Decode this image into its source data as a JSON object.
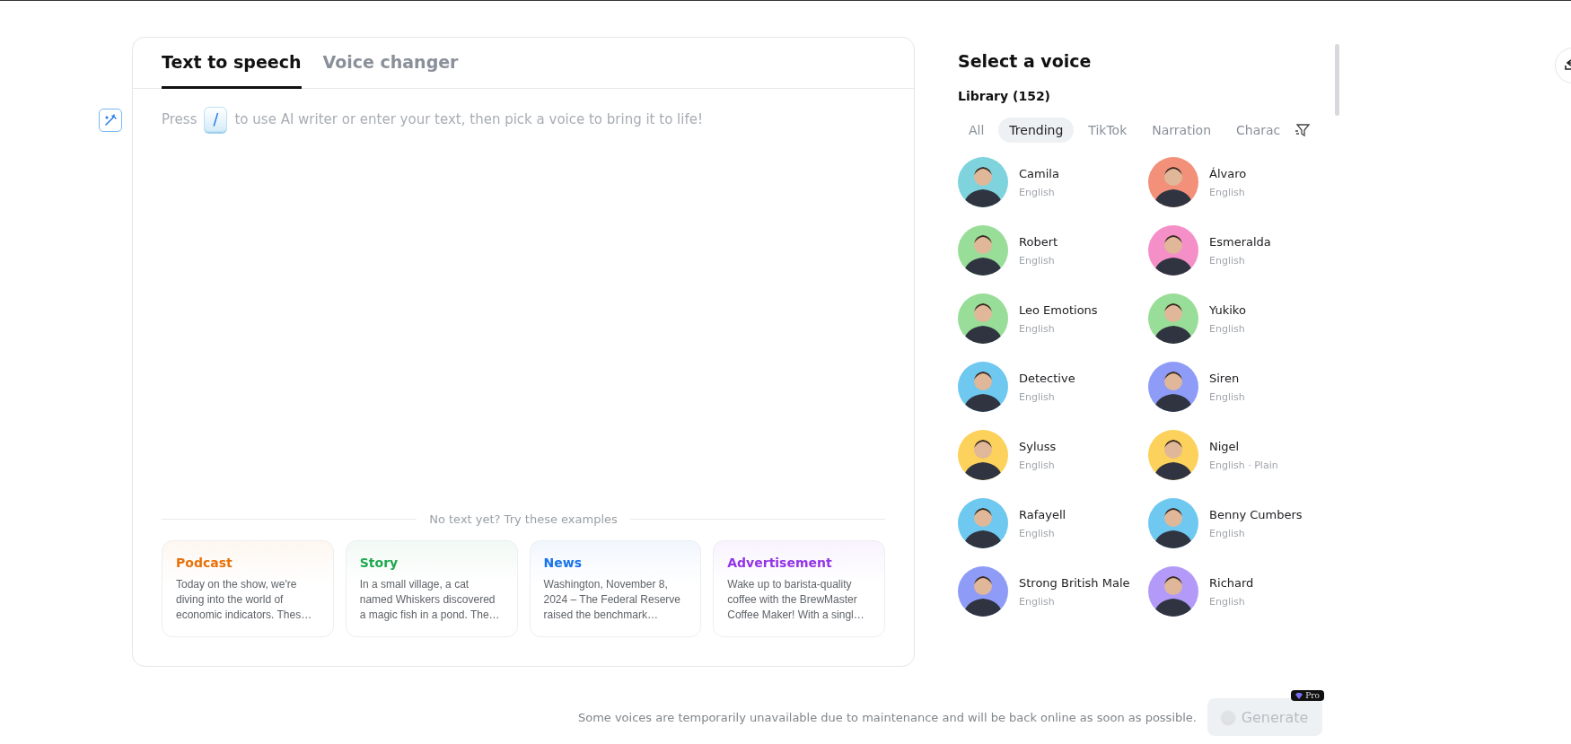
{
  "editor": {
    "tabs": [
      {
        "label": "Text to speech",
        "selected": true
      },
      {
        "label": "Voice changer",
        "selected": false
      }
    ],
    "placeholder_before": "Press",
    "shortcut_key": "/",
    "placeholder_after": "to use AI writer or enter your text, then pick a voice to bring it to life!",
    "examples_heading": "No text yet? Try these examples",
    "examples": [
      {
        "title": "Podcast",
        "color": "#e8710a",
        "text": "Today on the show, we're diving into the world of economic indicators. Thes…"
      },
      {
        "title": "Story",
        "color": "#1fa84f",
        "text": "In a small village, a cat named Whiskers discovered a magic fish in a pond. The…"
      },
      {
        "title": "News",
        "color": "#1a73e8",
        "text": "Washington, November 8, 2024 – The Federal Reserve raised the benchmark…"
      },
      {
        "title": "Advertisement",
        "color": "#9334e6",
        "text": "Wake up to barista-quality coffee with the BrewMaster Coffee Maker! With a singl…"
      }
    ]
  },
  "voice_panel": {
    "title": "Select a voice",
    "library": "Library (152)",
    "filters": [
      {
        "label": "All",
        "selected": false
      },
      {
        "label": "Trending",
        "selected": true
      },
      {
        "label": "TikTok",
        "selected": false
      },
      {
        "label": "Narration",
        "selected": false
      },
      {
        "label": "Charac",
        "selected": false
      }
    ],
    "voices": [
      {
        "name": "Camila",
        "language": "English",
        "color": "#7fd3dc"
      },
      {
        "name": "Álvaro",
        "language": "English",
        "color": "#f2907a"
      },
      {
        "name": "Robert",
        "language": "English",
        "color": "#98dd98"
      },
      {
        "name": "Esmeralda",
        "language": "English",
        "color": "#f58fc8"
      },
      {
        "name": "Leo Emotions",
        "language": "English",
        "color": "#98dd98"
      },
      {
        "name": "Yukiko",
        "language": "English",
        "color": "#98dd98"
      },
      {
        "name": "Detective",
        "language": "English",
        "color": "#6ec8f0"
      },
      {
        "name": "Siren",
        "language": "English",
        "color": "#8e9cf8"
      },
      {
        "name": "Syluss",
        "language": "English",
        "color": "#fcd15c"
      },
      {
        "name": "Nigel",
        "language": "English · Plain",
        "color": "#fcd15c"
      },
      {
        "name": "Rafayell",
        "language": "English",
        "color": "#6ec8f0"
      },
      {
        "name": "Benny Cumbers",
        "language": "English",
        "color": "#6ec8f0"
      },
      {
        "name": "Strong British Male",
        "language": "English",
        "color": "#8e9cf8"
      },
      {
        "name": "Richard",
        "language": "English",
        "color": "#b39af8"
      }
    ]
  },
  "footer": {
    "notice": "Some voices are temporarily unavailable due to maintenance and will be back online as soon as possible.",
    "generate": {
      "label": "Generate",
      "disabled": true,
      "badge": "Pro"
    }
  }
}
